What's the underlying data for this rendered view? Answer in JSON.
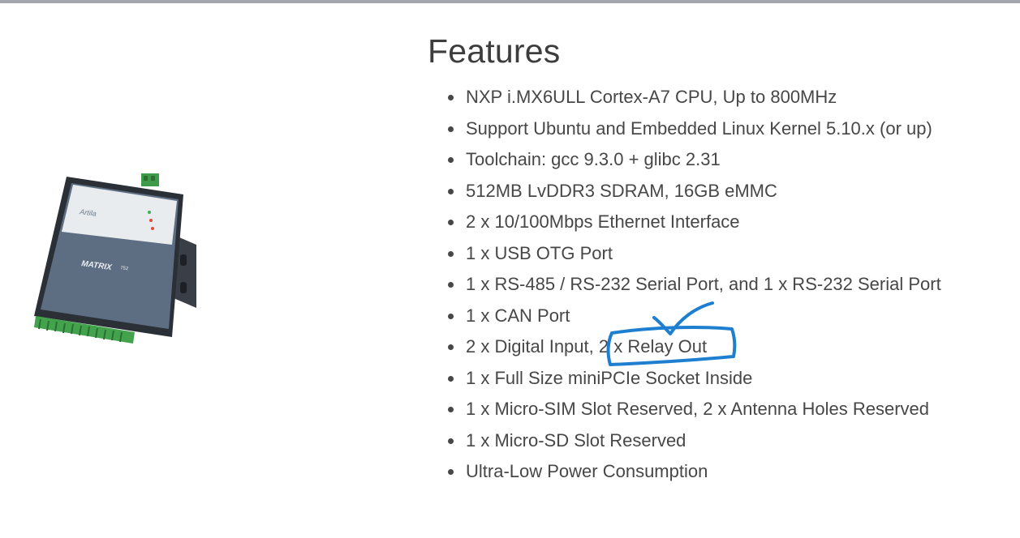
{
  "features": {
    "title": "Features",
    "items": [
      "NXP i.MX6ULL Cortex-A7 CPU, Up to 800MHz",
      "Support Ubuntu and Embedded Linux Kernel 5.10.x (or up)",
      "Toolchain: gcc 9.3.0 + glibc 2.31",
      "512MB LvDDR3 SDRAM, 16GB eMMC",
      "2 x 10/100Mbps Ethernet Interface",
      "1 x USB OTG Port",
      "1 x RS-485 / RS-232 Serial Port, and 1 x RS-232 Serial Port",
      "1 x CAN Port",
      "2 x Digital Input, 2 x Relay Out",
      "1 x Full Size miniPCIe Socket Inside",
      "1 x Micro-SIM Slot Reserved, 2 x Antenna Holes Reserved",
      "1 x Micro-SD Slot Reserved",
      "Ultra-Low Power Consumption"
    ]
  },
  "product": {
    "brand": "Artila",
    "model": "MATRIX",
    "model_suffix": "752"
  },
  "colors": {
    "annotation_ink": "#1e7fd0",
    "top_bar": "#a3a6ad",
    "text": "#474747"
  }
}
